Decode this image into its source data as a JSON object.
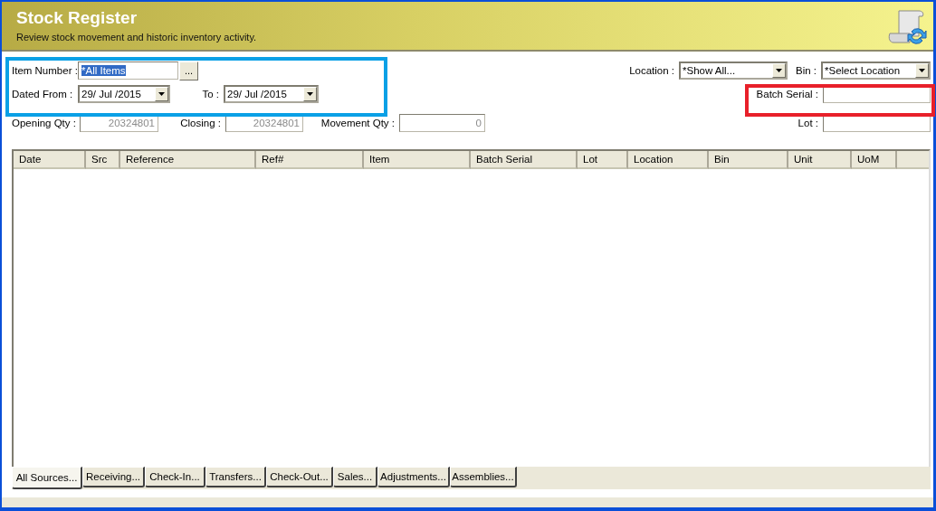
{
  "header": {
    "title": "Stock Register",
    "subtitle": "Review stock movement and historic inventory activity."
  },
  "filters": {
    "item_number": {
      "label": "Item Number :",
      "value": "*All Items",
      "text_selected": true,
      "button": "..."
    },
    "dated_from": {
      "label": "Dated From :",
      "value": "29/ Jul /2015"
    },
    "to": {
      "label": "To :",
      "value": "29/ Jul /2015"
    },
    "location": {
      "label": "Location :",
      "value": "*Show All..."
    },
    "bin": {
      "label": "Bin :",
      "value": "*Select Location"
    },
    "batch_serial": {
      "label": "Batch Serial :"
    },
    "lot": {
      "label": "Lot :"
    }
  },
  "totals": [
    {
      "label": "Opening Qty :",
      "value": "20324801",
      "disabled": true
    },
    {
      "label": "Closing :",
      "value": "20324801",
      "disabled": true
    },
    {
      "label": "Movement Qty :",
      "value": "0",
      "disabled": true
    }
  ],
  "table": {
    "columns": [
      "Date",
      "Src",
      "Reference",
      "Ref#",
      "Item",
      "Batch Serial",
      "Lot",
      "Location",
      "Bin",
      "Unit",
      "UoM"
    ]
  },
  "tabs": [
    {
      "label": "All Sources...",
      "selected": true
    },
    {
      "label": "Receiving...",
      "selected": false
    },
    {
      "label": "Check-In...",
      "selected": false
    },
    {
      "label": "Transfers...",
      "selected": false
    },
    {
      "label": "Check-Out...",
      "selected": false
    },
    {
      "label": "Sales...",
      "selected": false
    },
    {
      "label": "Adjustments...",
      "selected": false
    },
    {
      "label": "Assemblies...",
      "selected": false
    }
  ]
}
